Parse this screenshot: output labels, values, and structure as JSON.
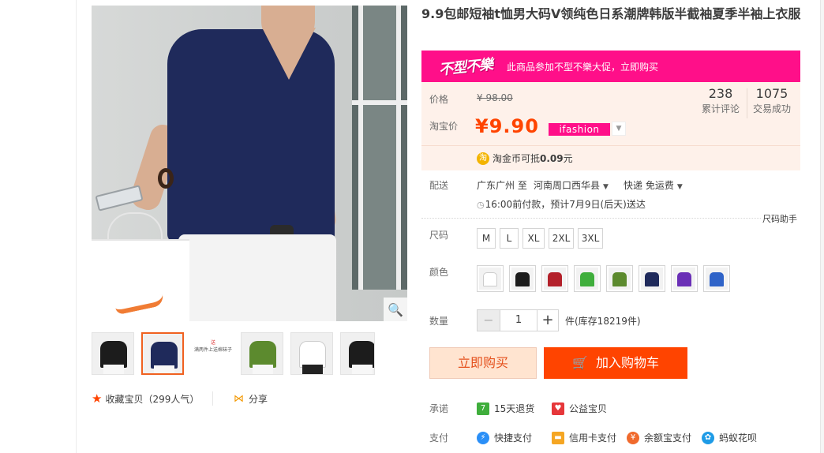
{
  "product": {
    "title": "9.9包邮短袖t恤男大码V领纯色日系潮牌韩版半截袖夏季半袖上衣服"
  },
  "gallery": {
    "thumbs_text": {
      "line1": "送",
      "line2": "满两件上送棉袜子"
    }
  },
  "actions": {
    "collect": "收藏宝贝（299人气）",
    "share": "分享"
  },
  "promo": {
    "logo": "不型不樂",
    "text": "此商品参加不型不樂大促，立即购买"
  },
  "price": {
    "label": "价格",
    "original": "¥ 98.00",
    "taobao_label": "淘宝价",
    "taobao_price": "¥9.90",
    "badge": "ifashion"
  },
  "stats": {
    "reviews_count": "238",
    "reviews_label": "累计评论",
    "sales_count": "1075",
    "sales_label": "交易成功"
  },
  "coin": {
    "icon": "淘",
    "text_prefix": "淘金币可抵",
    "amount": "0.09",
    "text_suffix": "元"
  },
  "shipping": {
    "label": "配送",
    "from": "广东广州 至",
    "dest": "河南周口西华县",
    "method": "快递 免运费",
    "eta": "16:00前付款，预计7月9日(后天)送达"
  },
  "size": {
    "label": "尺码",
    "helper": "尺码助手",
    "options": [
      "M",
      "L",
      "XL",
      "2XL",
      "3XL"
    ]
  },
  "color": {
    "label": "颜色",
    "swatches": [
      "#ffffff",
      "#1c1c1c",
      "#b3202a",
      "#3fae3c",
      "#5c8a2e",
      "#1f2a5b",
      "#6a2fb6",
      "#2f63c8"
    ]
  },
  "quantity": {
    "label": "数量",
    "minus": "−",
    "value": "1",
    "plus": "+",
    "stock": "件(库存18219件)"
  },
  "buttons": {
    "buy_now": "立即购买",
    "add_to_cart": "加入购物车"
  },
  "promise": {
    "label": "承诺",
    "items": [
      {
        "icon": "7",
        "label": "15天退货",
        "color": "#3fae3c"
      },
      {
        "icon": "♥",
        "label": "公益宝贝",
        "color": "#e6373a"
      }
    ]
  },
  "payment": {
    "label": "支付",
    "items": [
      {
        "icon": "⚡",
        "label": "快捷支付",
        "color": "#2a8ff7"
      },
      {
        "icon": "▬",
        "label": "信用卡支付",
        "color": "#f5a623"
      },
      {
        "icon": "¥",
        "label": "余额宝支付",
        "color": "#f06a2d"
      },
      {
        "icon": "✿",
        "label": "蚂蚁花呗",
        "color": "#1e9be6"
      }
    ]
  },
  "colors": {
    "accent": "#ff4400",
    "promo_pink": "#ff0f89",
    "price_orange": "#ff4400"
  }
}
